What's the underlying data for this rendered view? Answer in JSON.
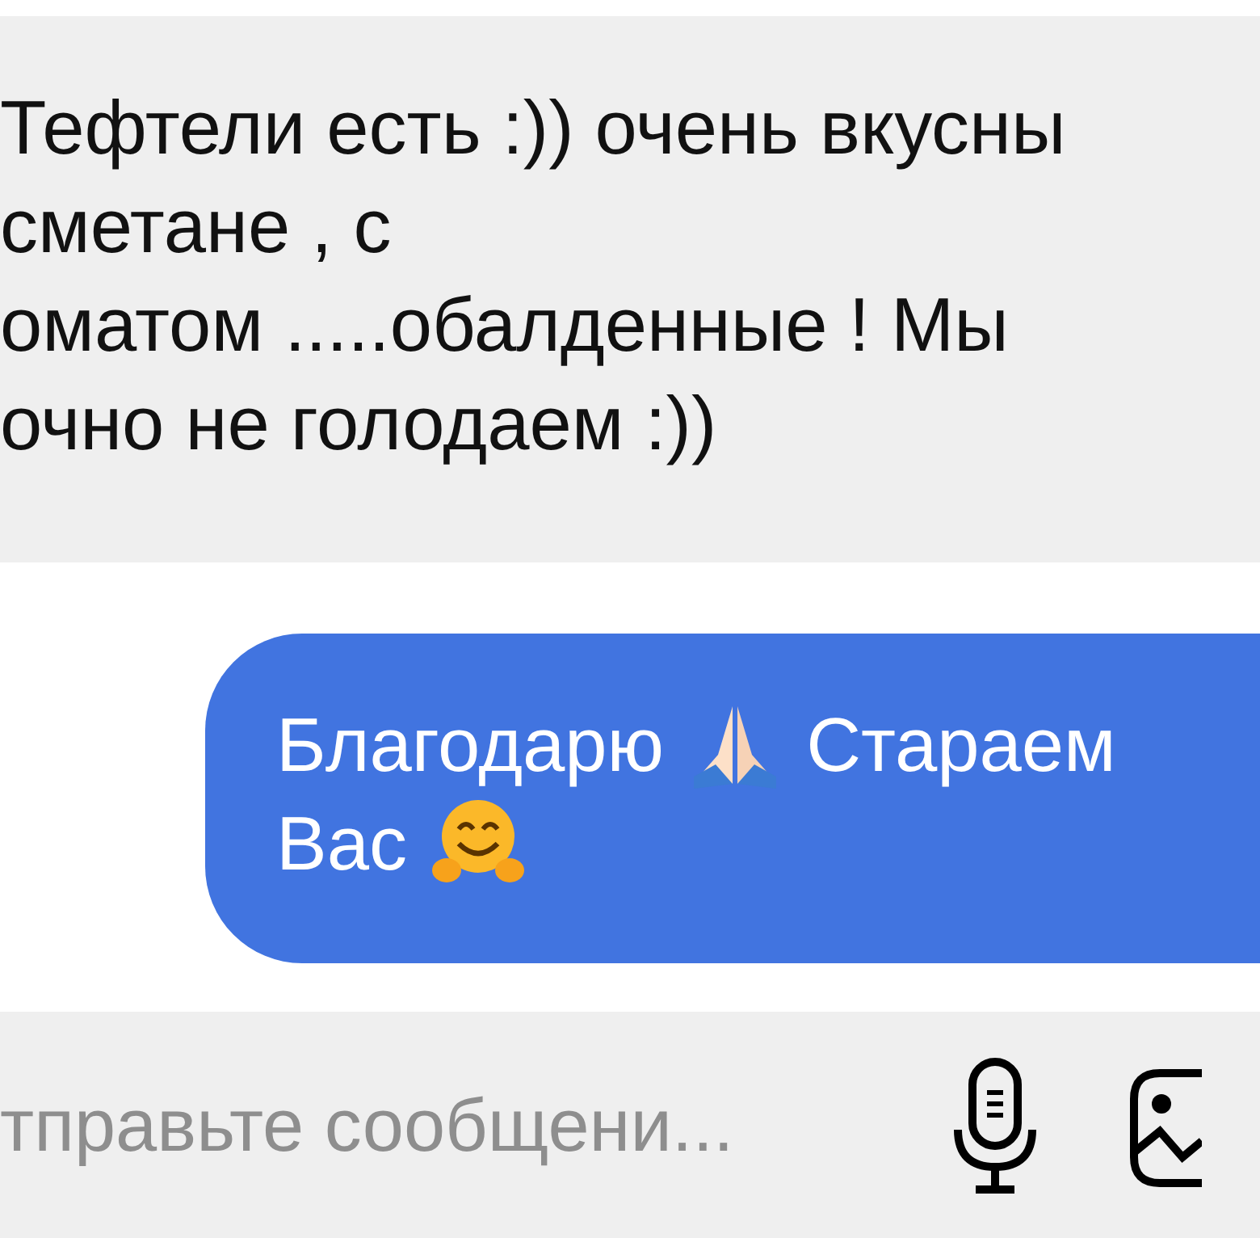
{
  "messages": [
    {
      "kind": "incoming",
      "lines": [
        "Тефтели есть :)) очень вкусны",
        "сметане , с",
        "оматом .....обалденные ! Мы",
        "очно не голодаем :))"
      ]
    },
    {
      "kind": "outgoing",
      "lines": [
        [
          {
            "kind": "text",
            "text": "Благодарю"
          },
          {
            "kind": "praying-emoji"
          },
          {
            "kind": "text",
            "text": "Стараем"
          }
        ],
        [
          {
            "kind": "text",
            "text": "Вас"
          },
          {
            "kind": "hug-emoji"
          }
        ]
      ]
    }
  ],
  "composer": {
    "placeholder": "тправьте сообщени..."
  }
}
